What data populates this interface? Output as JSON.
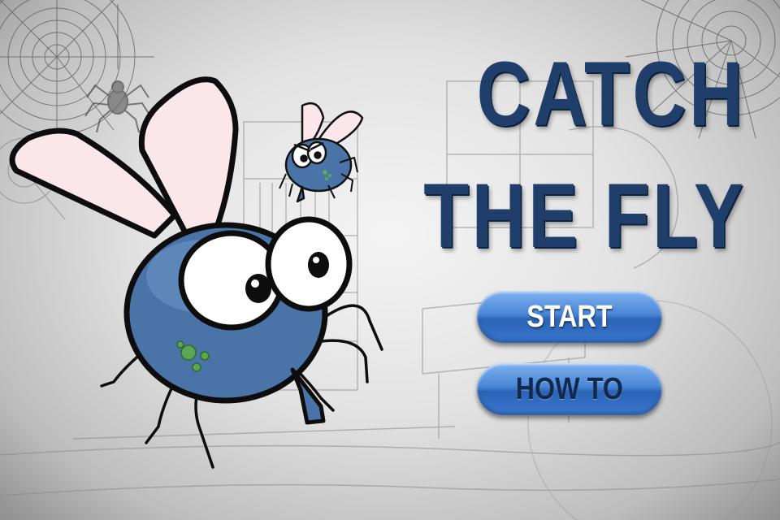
{
  "title": {
    "line1": "CATCH",
    "line2": "THE FLY"
  },
  "menu": {
    "start_label": "START",
    "howto_label": "HOW TO"
  },
  "colors": {
    "title_text": "#1f3e6a",
    "button_blue": "#3a78cf",
    "fly_body": "#4a74a8",
    "wing_fill": "#fbe6ea",
    "background_paper": "#e6e6e6"
  },
  "icons": [
    "spider-web-icon",
    "spider-icon",
    "fly-mascot-large",
    "fly-mascot-small"
  ]
}
